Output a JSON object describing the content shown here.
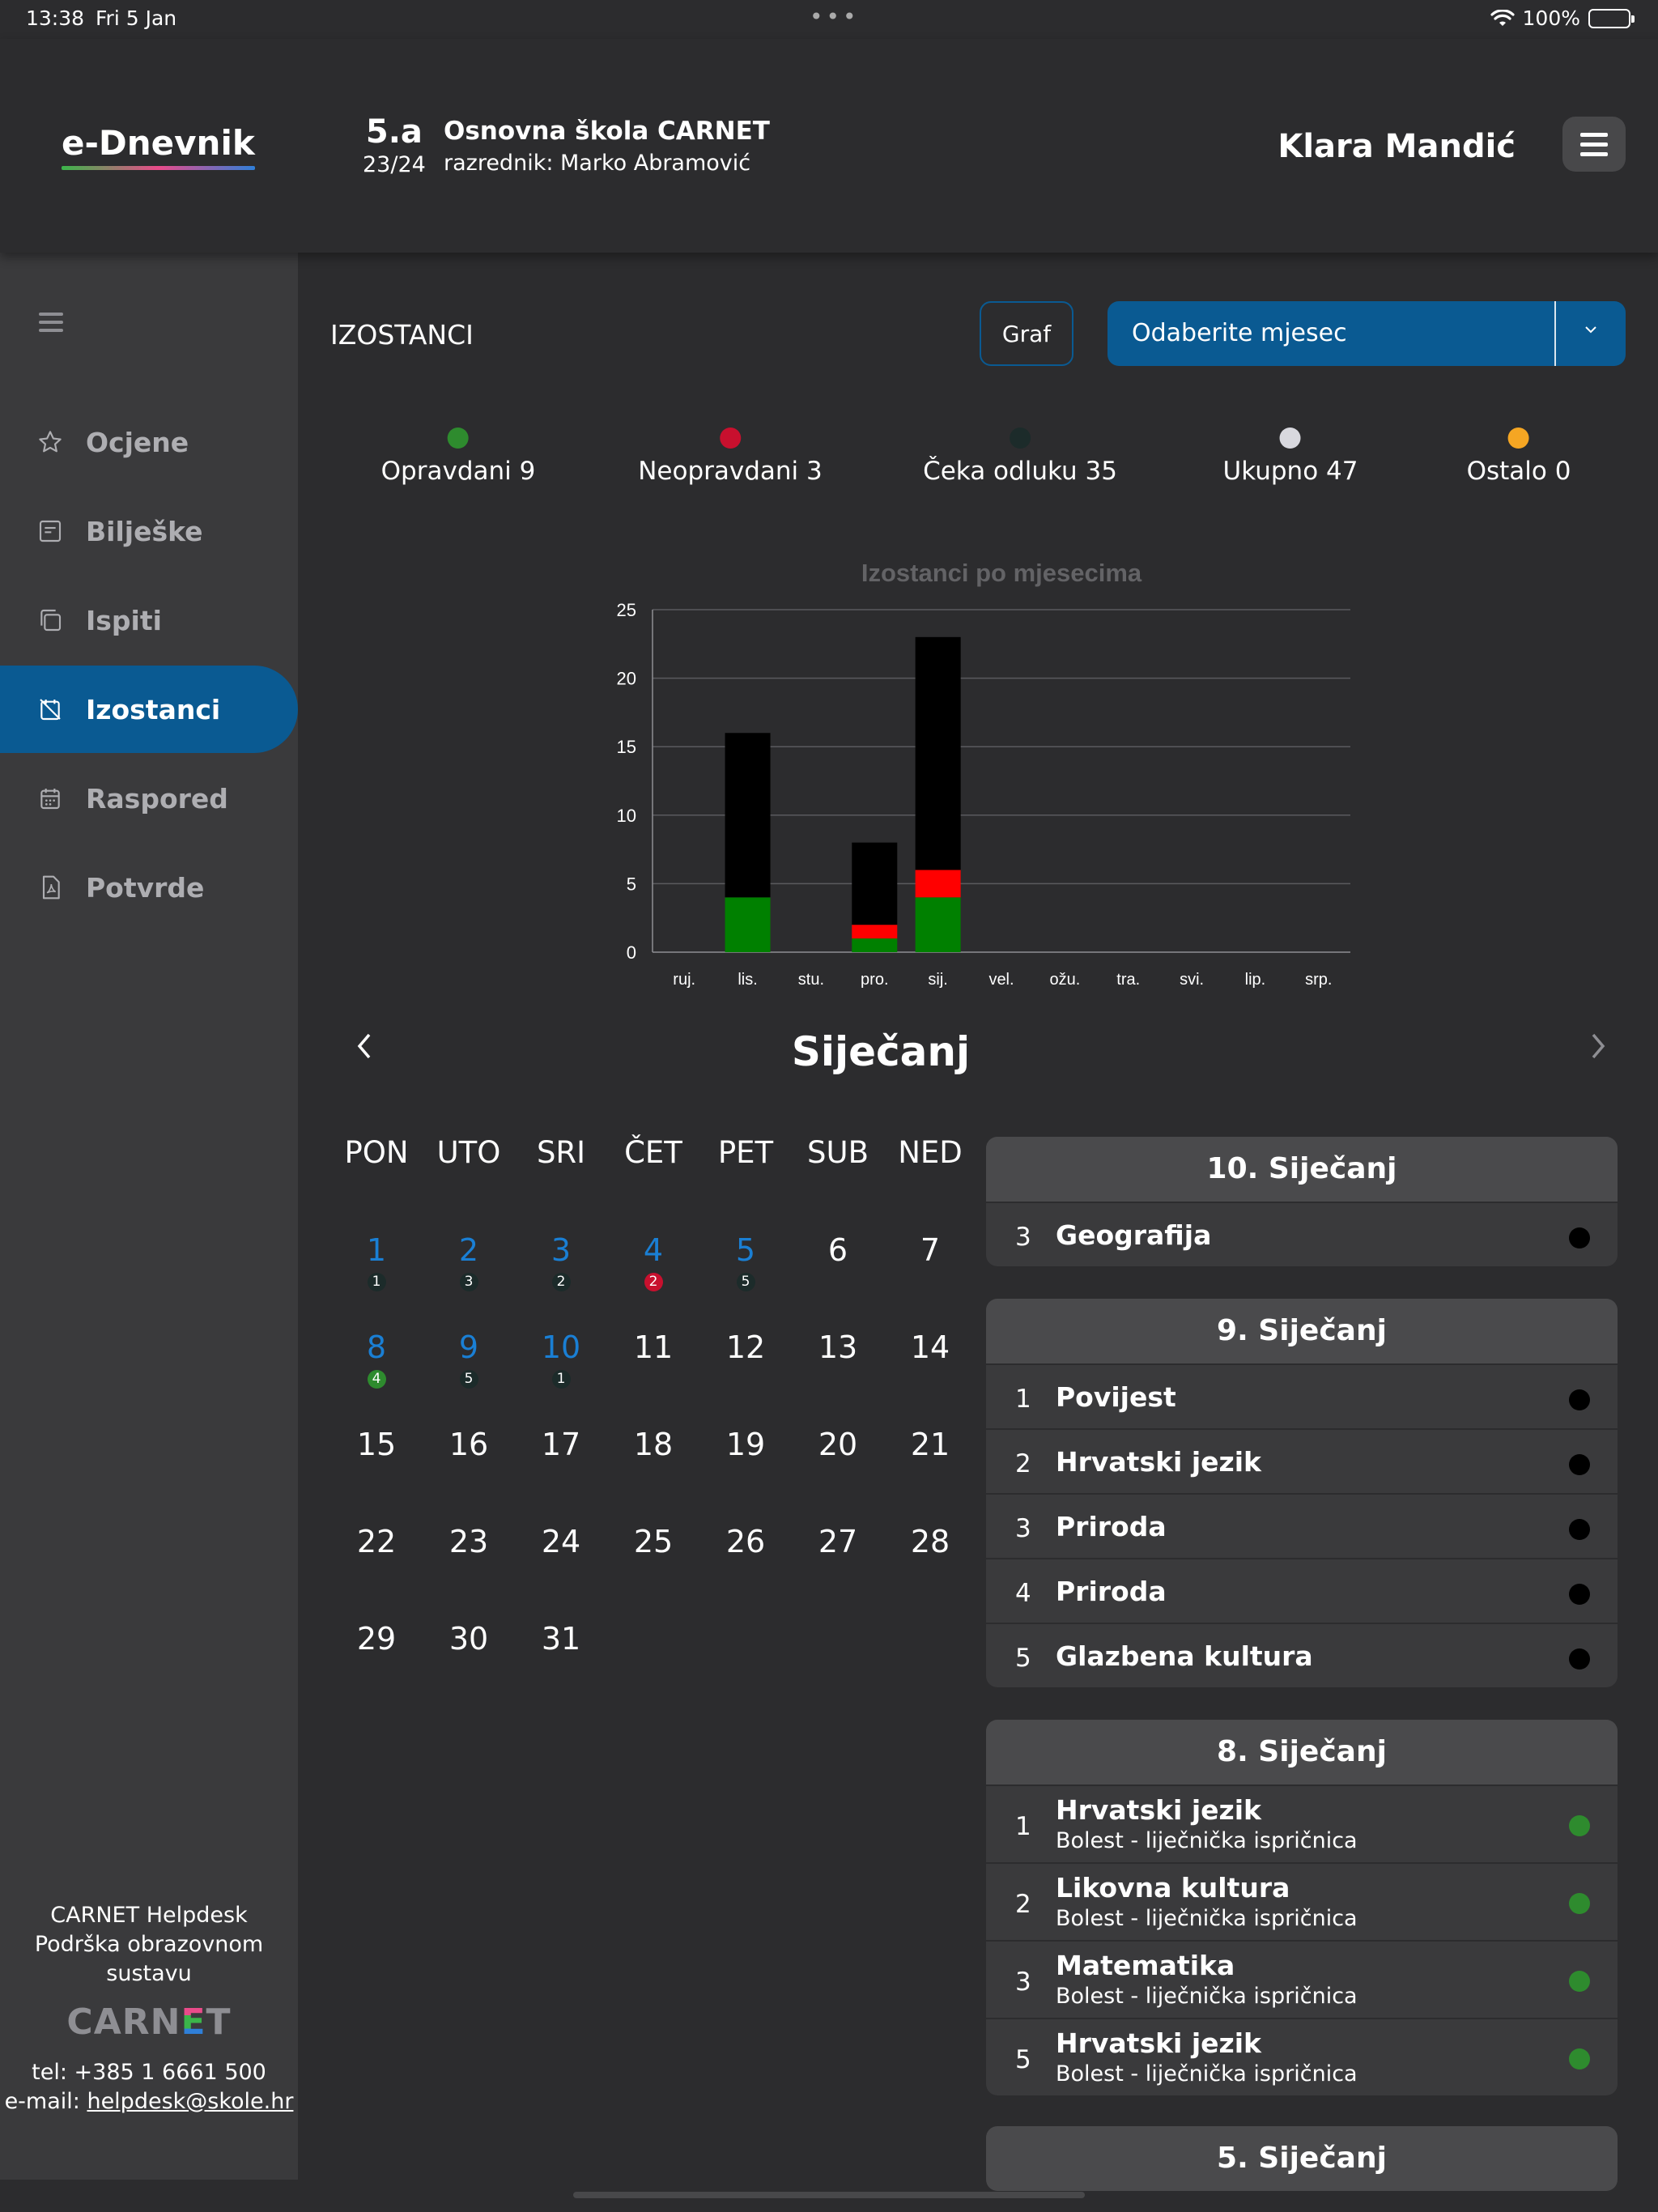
{
  "status_bar": {
    "time": "13:38",
    "date": "Fri 5 Jan",
    "battery": "100%"
  },
  "header": {
    "logo": "e-Dnevnik",
    "class_name": "5.a",
    "school_year": "23/24",
    "school_name": "Osnovna škola CARNET",
    "teacher": "razrednik: Marko Abramović",
    "user_name": "Klara Mandić"
  },
  "sidebar": {
    "items": [
      {
        "label": "Ocjene",
        "icon": "star-icon"
      },
      {
        "label": "Bilješke",
        "icon": "note-icon"
      },
      {
        "label": "Ispiti",
        "icon": "copy-icon"
      },
      {
        "label": "Izostanci",
        "icon": "calendar-x-icon",
        "active": true
      },
      {
        "label": "Raspored",
        "icon": "calendar-icon"
      },
      {
        "label": "Potvrde",
        "icon": "pdf-icon"
      }
    ],
    "helpdesk": {
      "title": "CARNET Helpdesk",
      "subtitle": "Podrška obrazovnom sustavu",
      "logo": "CARNET",
      "phone": "tel: +385 1 6661 500",
      "email_label": "e-mail: ",
      "email": "helpdesk@skole.hr"
    }
  },
  "main": {
    "title": "IZOSTANCI",
    "graf_button": "Graf",
    "month_select": "Odaberite mjesec",
    "legend": [
      {
        "label": "Opravdani 9",
        "color": "#2e8b2e"
      },
      {
        "label": "Neopravdani 3",
        "color": "#c8102e"
      },
      {
        "label": "Čeka odluku 35",
        "color": "#1c2b2a"
      },
      {
        "label": "Ukupno 47",
        "color": "#d8d8de"
      },
      {
        "label": "Ostalo 0",
        "color": "#f5a623"
      }
    ]
  },
  "chart_data": {
    "type": "bar",
    "stacked": true,
    "title": "Izostanci po mjesecima",
    "categories": [
      "ruj.",
      "lis.",
      "stu.",
      "pro.",
      "sij.",
      "vel.",
      "ožu.",
      "tra.",
      "svi.",
      "lip.",
      "srp."
    ],
    "series": [
      {
        "color": "#008000",
        "values": [
          0,
          4,
          0,
          1,
          4,
          0,
          0,
          0,
          0,
          0,
          0
        ]
      },
      {
        "color": "#ff0000",
        "values": [
          0,
          0,
          0,
          1,
          2,
          0,
          0,
          0,
          0,
          0,
          0
        ]
      },
      {
        "color": "#000000",
        "values": [
          0,
          12,
          0,
          6,
          17,
          0,
          0,
          0,
          0,
          0,
          0
        ]
      }
    ],
    "yticks": [
      0,
      5,
      10,
      15,
      20,
      25
    ],
    "ylim": [
      0,
      25
    ],
    "grid": true
  },
  "calendar": {
    "month": "Siječanj",
    "weekdays": [
      "PON",
      "UTO",
      "SRI",
      "ČET",
      "PET",
      "SUB",
      "NED"
    ],
    "days": [
      {
        "d": "1",
        "badge": "1",
        "kind": "dark"
      },
      {
        "d": "2",
        "badge": "3",
        "kind": "dark"
      },
      {
        "d": "3",
        "badge": "2",
        "kind": "dark"
      },
      {
        "d": "4",
        "badge": "2",
        "kind": "red"
      },
      {
        "d": "5",
        "badge": "5",
        "kind": "dark"
      },
      {
        "d": "6"
      },
      {
        "d": "7"
      },
      {
        "d": "8",
        "badge": "4",
        "kind": "green"
      },
      {
        "d": "9",
        "badge": "5",
        "kind": "dark"
      },
      {
        "d": "10",
        "badge": "1",
        "kind": "dark"
      },
      {
        "d": "11"
      },
      {
        "d": "12"
      },
      {
        "d": "13"
      },
      {
        "d": "14"
      },
      {
        "d": "15"
      },
      {
        "d": "16"
      },
      {
        "d": "17"
      },
      {
        "d": "18"
      },
      {
        "d": "19"
      },
      {
        "d": "20"
      },
      {
        "d": "21"
      },
      {
        "d": "22"
      },
      {
        "d": "23"
      },
      {
        "d": "24"
      },
      {
        "d": "25"
      },
      {
        "d": "26"
      },
      {
        "d": "27"
      },
      {
        "d": "28"
      },
      {
        "d": "29"
      },
      {
        "d": "30"
      },
      {
        "d": "31"
      }
    ]
  },
  "absence_days": [
    {
      "title": "10. Siječanj",
      "rows": [
        {
          "period": "3",
          "subject": "Geografija"
        }
      ]
    },
    {
      "title": "9. Siječanj",
      "rows": [
        {
          "period": "1",
          "subject": "Povijest"
        },
        {
          "period": "2",
          "subject": "Hrvatski jezik"
        },
        {
          "period": "3",
          "subject": "Priroda"
        },
        {
          "period": "4",
          "subject": "Priroda"
        },
        {
          "period": "5",
          "subject": "Glazbena kultura"
        }
      ]
    },
    {
      "title": "8. Siječanj",
      "rows": [
        {
          "period": "1",
          "subject": "Hrvatski jezik",
          "note": "Bolest - liječnička ispričnica"
        },
        {
          "period": "2",
          "subject": "Likovna kultura",
          "note": "Bolest - liječnička ispričnica"
        },
        {
          "period": "3",
          "subject": "Matematika",
          "note": "Bolest - liječnička ispričnica"
        },
        {
          "period": "5",
          "subject": "Hrvatski jezik",
          "note": "Bolest - liječnička ispričnica"
        }
      ]
    },
    {
      "title": "5. Siječanj",
      "rows": []
    }
  ]
}
